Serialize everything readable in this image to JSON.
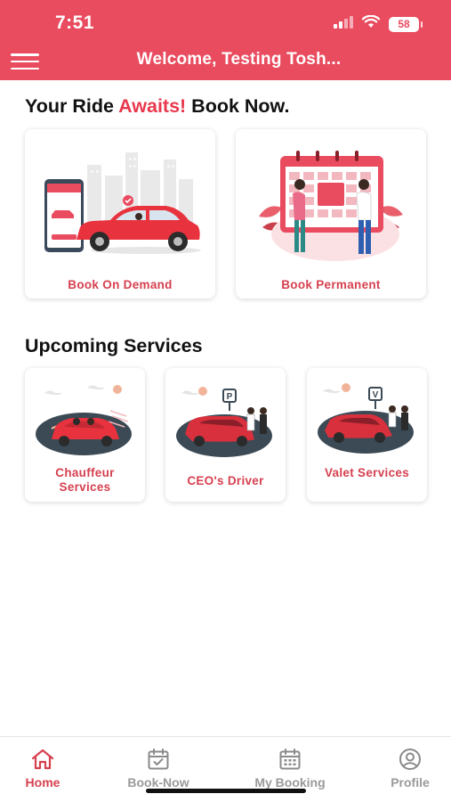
{
  "status_bar": {
    "time": "7:51",
    "battery": "58"
  },
  "header": {
    "title": "Welcome, Testing Tosh..."
  },
  "hero": {
    "title_part1": "Your Ride ",
    "title_accent": "Awaits!",
    "title_part2": " Book Now."
  },
  "booking_options": [
    {
      "label": "Book On Demand"
    },
    {
      "label": "Book Permanent"
    }
  ],
  "upcoming": {
    "title": "Upcoming Services",
    "services": [
      {
        "label": "Chauffeur Services"
      },
      {
        "label": "CEO's Driver"
      },
      {
        "label": "Valet Services"
      }
    ]
  },
  "bottom_nav": [
    {
      "label": "Home",
      "icon": "home-icon",
      "active": true
    },
    {
      "label": "Book-Now",
      "icon": "calendar-check-icon",
      "active": false
    },
    {
      "label": "My Booking",
      "icon": "calendar-icon",
      "active": false
    },
    {
      "label": "Profile",
      "icon": "user-circle-icon",
      "active": false
    }
  ],
  "colors": {
    "brand": "#e94b5f",
    "accent_text": "#d6404f",
    "inactive": "#9a9a9a"
  }
}
